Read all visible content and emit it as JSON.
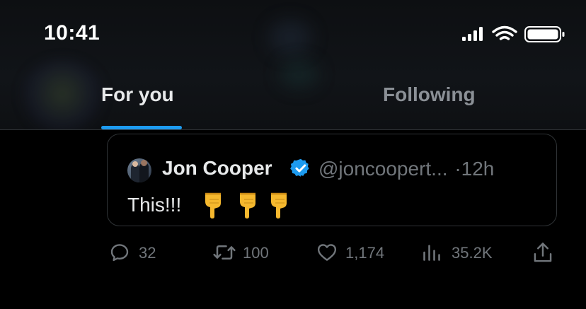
{
  "status_bar": {
    "time": "10:41",
    "icons": [
      "cellular-signal-icon",
      "wifi-icon",
      "battery-icon"
    ]
  },
  "tabs": [
    {
      "label": "For you",
      "active": true
    },
    {
      "label": "Following",
      "active": false
    }
  ],
  "colors": {
    "accent": "#1d9bf0",
    "text_primary": "#e7e9ea",
    "text_secondary": "#71767b",
    "border": "#2f3336",
    "emoji": "#f5b82e"
  },
  "quoted_tweet": {
    "author_name": "Jon Cooper",
    "verified": true,
    "handle": "@joncoopert...",
    "separator": "·",
    "time": "12h",
    "text": "This!!!",
    "emojis": [
      "backhand-index-pointing-down",
      "backhand-index-pointing-down",
      "backhand-index-pointing-down"
    ]
  },
  "actions": {
    "replies": "32",
    "retweets": "100",
    "likes": "1,174",
    "views": "35.2K",
    "share_icon": "share-icon"
  }
}
